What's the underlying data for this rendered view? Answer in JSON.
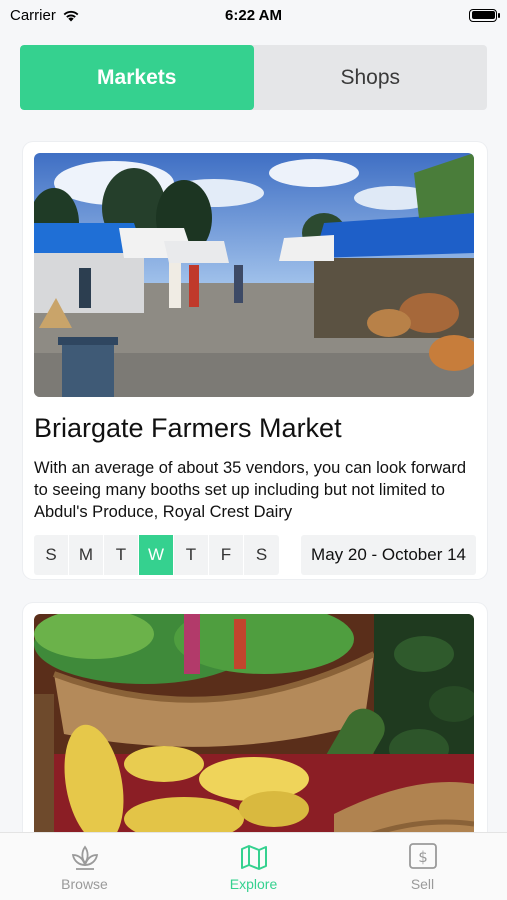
{
  "status_bar": {
    "carrier": "Carrier",
    "time": "6:22 AM",
    "battery_level": 1.0
  },
  "segmented": {
    "items": [
      {
        "label": "Markets",
        "active": true
      },
      {
        "label": "Shops",
        "active": false
      }
    ],
    "accent": "#35d18f"
  },
  "markets": [
    {
      "title": "Briargate Farmers Market",
      "description": "With an average of about 35 vendors, you can look forward to seeing many booths set up including but not limited to Abdul's Produce, Royal Crest Dairy",
      "days": [
        "S",
        "M",
        "T",
        "W",
        "T",
        "F",
        "S"
      ],
      "active_day_index": 3,
      "date_range": "May 20 - October 14",
      "image": "farmers-market-tents-photo"
    },
    {
      "image": "produce-baskets-photo"
    }
  ],
  "tab_bar": {
    "items": [
      {
        "label": "Browse",
        "icon": "sprout-icon",
        "active": false
      },
      {
        "label": "Explore",
        "icon": "map-icon",
        "active": true
      },
      {
        "label": "Sell",
        "icon": "dollar-icon",
        "active": false
      }
    ],
    "active_color": "#35d18f",
    "inactive_color": "#9a9a9a"
  }
}
